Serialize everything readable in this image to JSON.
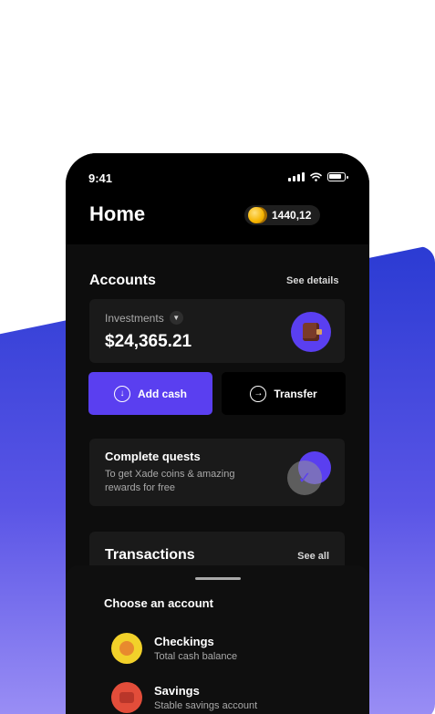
{
  "status": {
    "time": "9:41"
  },
  "header": {
    "title": "Home",
    "coins": "1440,12"
  },
  "accounts": {
    "title": "Accounts",
    "see_details": "See details",
    "investments_label": "Investments",
    "investments_value": "$24,365.21"
  },
  "actions": {
    "add_cash": "Add cash",
    "transfer": "Transfer"
  },
  "quests": {
    "title": "Complete quests",
    "description": "To get Xade coins & amazing rewards for free"
  },
  "transactions": {
    "title": "Transactions",
    "see_all": "See all"
  },
  "sheet": {
    "title": "Choose an account",
    "items": [
      {
        "name": "Checkings",
        "subtitle": "Total cash balance",
        "icon": "coin-icon",
        "color": "#f2d12a"
      },
      {
        "name": "Savings",
        "subtitle": "Stable savings account",
        "icon": "piggy-bank-icon",
        "color": "#e24d3a"
      }
    ]
  },
  "colors": {
    "accent": "#5a3ff0",
    "background_gradient_top": "#2b3bd3",
    "background_gradient_bottom": "#9b8ff5"
  }
}
